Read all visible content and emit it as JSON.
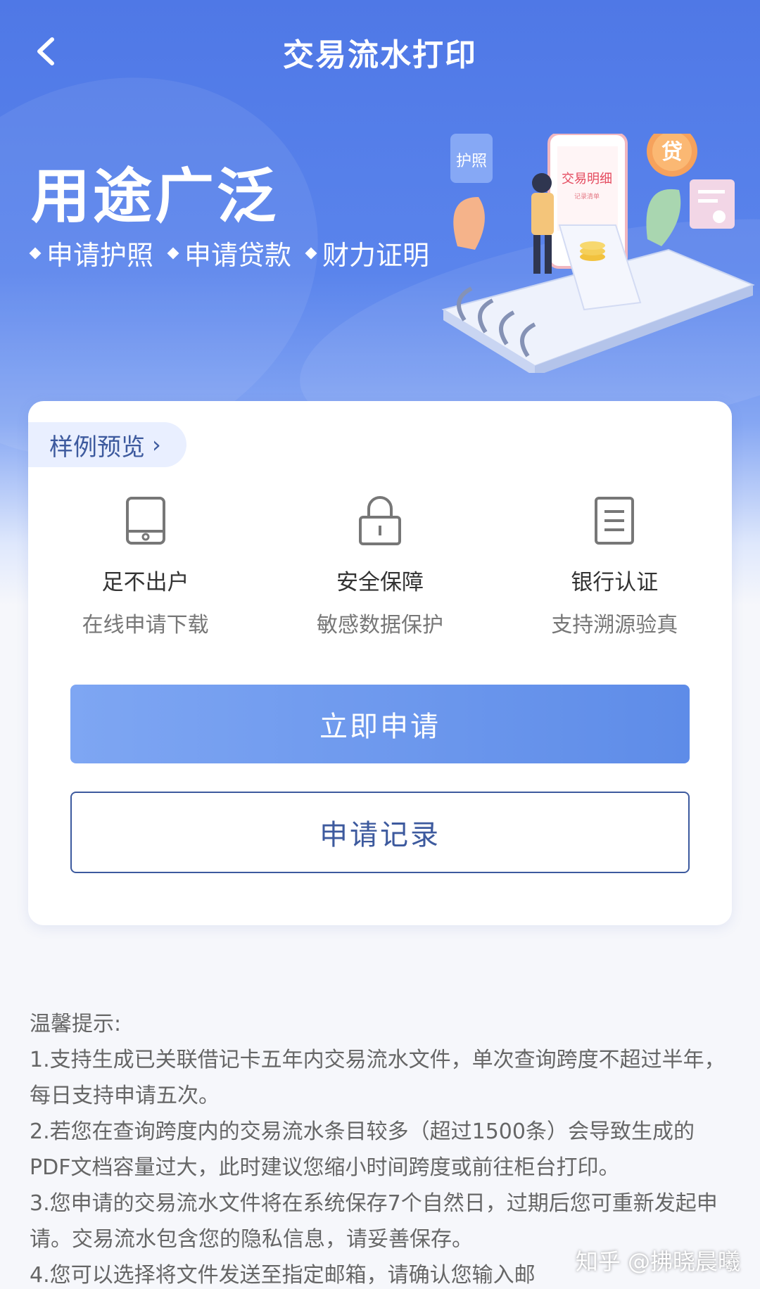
{
  "nav": {
    "title": "交易流水打印",
    "back_icon": "chevron-left-icon"
  },
  "hero": {
    "headline": "用途广泛",
    "tags": [
      "申请护照",
      "申请贷款",
      "财力证明"
    ],
    "illustration": {
      "statement_label": "交易明细",
      "statement_sub": "记录清单",
      "passport_label": "护照",
      "loan_label": "贷"
    }
  },
  "card": {
    "sample_label": "样例预览",
    "features": [
      {
        "icon": "tablet-download-icon",
        "title": "足不出户",
        "subtitle": "在线申请下载"
      },
      {
        "icon": "lock-icon",
        "title": "安全保障",
        "subtitle": "敏感数据保护"
      },
      {
        "icon": "document-icon",
        "title": "银行认证",
        "subtitle": "支持溯源验真"
      }
    ],
    "apply_label": "立即申请",
    "records_label": "申请记录"
  },
  "tips": {
    "heading": "温馨提示:",
    "items": [
      "1.支持生成已关联借记卡五年内交易流水文件，单次查询跨度不超过半年，每日支持申请五次。",
      "2.若您在查询跨度内的交易流水条目较多（超过1500条）会导致生成的PDF文档容量过大，此时建议您缩小时间跨度或前往柜台打印。",
      "3.您申请的交易流水文件将在系统保存7个自然日，过期后您可重新发起申请。交易流水包含您的隐私信息，请妥善保存。",
      "4.您可以选择将文件发送至指定邮箱，请确认您输入邮"
    ]
  },
  "watermark": "知乎 @拂晓晨曦",
  "colors": {
    "brand": "#4f78e6",
    "button_primary": "#6b96ee",
    "button_outline": "#3d5a9e"
  }
}
